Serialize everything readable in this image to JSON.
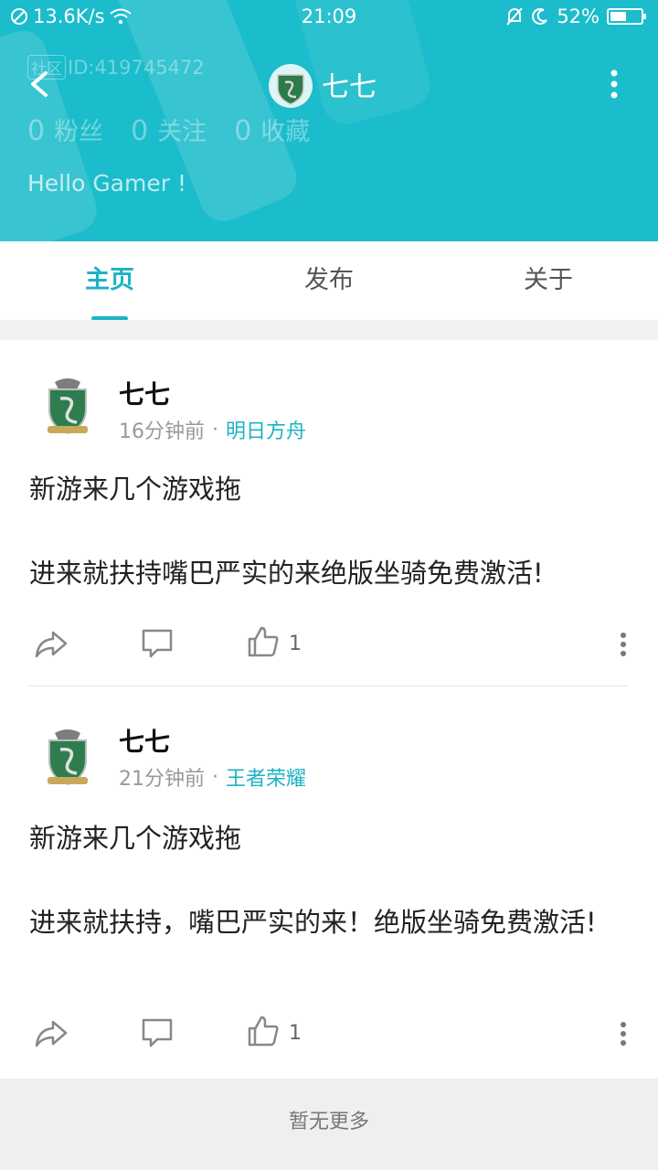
{
  "status_bar": {
    "speed": "13.6K/s",
    "time": "21:09",
    "battery": "52%"
  },
  "header": {
    "badge": "社区",
    "id_text": "ID:419745472",
    "name": "七七",
    "stats": [
      {
        "count": "0",
        "label": "粉丝"
      },
      {
        "count": "0",
        "label": "关注"
      },
      {
        "count": "0",
        "label": "收藏"
      }
    ],
    "bio": "Hello Gamer !"
  },
  "tabs": [
    {
      "label": "主页"
    },
    {
      "label": "发布"
    },
    {
      "label": "关于"
    }
  ],
  "posts": [
    {
      "author": "七七",
      "time": "16分钟前",
      "dot": "·",
      "game": "明日方舟",
      "text": "新游来几个游戏拖\n\n进来就扶持嘴巴严实的来绝版坐骑免费激活!",
      "likes": "1"
    },
    {
      "author": "七七",
      "time": "21分钟前",
      "dot": "·",
      "game": "王者荣耀",
      "text": "新游来几个游戏拖\n\n进来就扶持，嘴巴严实的来！绝版坐骑免费激活!",
      "likes": "1"
    }
  ],
  "footer": {
    "text": "暂无更多"
  },
  "colors": {
    "primary": "#1bbccb",
    "accent": "#1bb3c4"
  },
  "icons": [
    "back-icon",
    "more-vertical-icon",
    "share-icon",
    "comment-icon",
    "thumbs-up-icon",
    "wifi-icon",
    "mute-icon",
    "moon-icon",
    "battery-icon",
    "no-sim-icon"
  ]
}
